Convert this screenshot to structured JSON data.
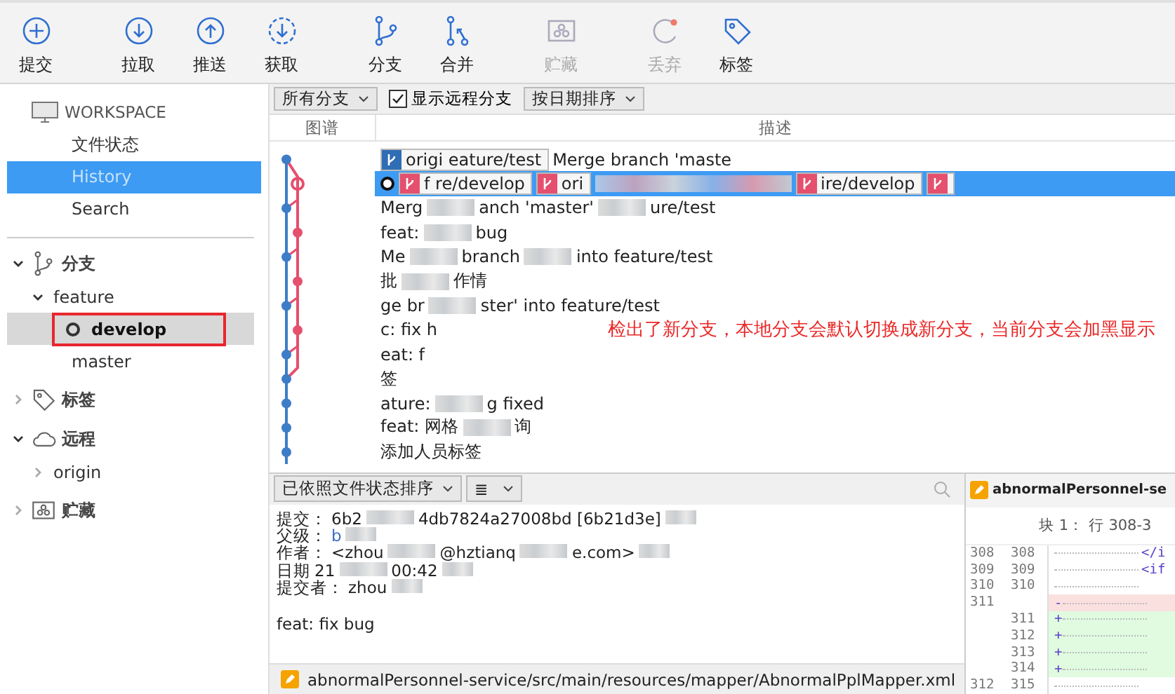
{
  "toolbar": [
    {
      "label": "提交",
      "disabled": false
    },
    {
      "label": "拉取",
      "disabled": false
    },
    {
      "label": "推送",
      "disabled": false
    },
    {
      "label": "获取",
      "disabled": false
    },
    {
      "label": "分支",
      "disabled": false
    },
    {
      "label": "合并",
      "disabled": false
    },
    {
      "label": "贮藏",
      "disabled": true
    },
    {
      "label": "丢弃",
      "disabled": true
    },
    {
      "label": "标签",
      "disabled": false
    }
  ],
  "sidebar": {
    "workspace": "WORKSPACE",
    "workspace_items": [
      {
        "label": "文件状态",
        "selected": false
      },
      {
        "label": "History",
        "selected": true
      },
      {
        "label": "Search",
        "selected": false
      }
    ],
    "sections": [
      {
        "label": "分支",
        "expanded": true,
        "children": [
          {
            "label": "feature",
            "expanded": true,
            "children": [
              {
                "label": "develop",
                "current": true,
                "highlighted": true
              }
            ]
          },
          {
            "label": "master",
            "current": false,
            "highlighted": false
          }
        ]
      },
      {
        "label": "标签",
        "expanded": false
      },
      {
        "label": "远程",
        "expanded": true,
        "children": [
          {
            "label": "origin",
            "expanded": false
          }
        ]
      },
      {
        "label": "贮藏",
        "expanded": false
      }
    ]
  },
  "filter_bar": {
    "branch_filter": "所有分支",
    "show_remote": {
      "label": "显示远程分支",
      "checked": true
    },
    "sort": "按日期排序"
  },
  "columns": [
    "图谱",
    "描述"
  ],
  "commits": [
    {
      "selected": false,
      "head": false,
      "kind": "main",
      "badges": [
        {
          "label": "origi eature/test",
          "color": "#2f6db5"
        }
      ],
      "parts": [
        "Merge branch 'maste"
      ]
    },
    {
      "selected": true,
      "head": true,
      "kind": "side",
      "badges": [
        {
          "label": "f re/develop",
          "color": "#e5506e"
        },
        {
          "label": "ori",
          "color": "#e5506e"
        }
      ],
      "tail_badges": [
        {
          "label": "ire/develop",
          "color": "#e5506e"
        },
        {
          "color": "#e5506e"
        }
      ]
    },
    {
      "selected": false,
      "head": false,
      "kind": "main",
      "parts": [
        "Merg",
        "anch 'master'",
        "ure/test"
      ]
    },
    {
      "selected": false,
      "head": false,
      "kind": "side",
      "parts": [
        "feat:",
        "bug"
      ]
    },
    {
      "selected": false,
      "head": false,
      "kind": "main",
      "parts": [
        "Me",
        "branch",
        "into feature/test"
      ]
    },
    {
      "selected": false,
      "head": false,
      "kind": "side",
      "parts": [
        "批",
        "作情"
      ]
    },
    {
      "selected": false,
      "head": false,
      "kind": "main",
      "parts": [
        "ge br",
        "ster' into feature/test"
      ]
    },
    {
      "selected": false,
      "head": false,
      "kind": "side",
      "parts": [
        "c: fix h"
      ],
      "note": "检出了新分支，本地分支会默认切换成新分支，当前分支会加黑显示"
    },
    {
      "selected": false,
      "head": false,
      "kind": "main",
      "parts": [
        "eat: f"
      ]
    },
    {
      "selected": false,
      "head": false,
      "kind": "main",
      "parts": [
        "签"
      ]
    },
    {
      "selected": false,
      "head": false,
      "kind": "main",
      "parts": [
        "ature:",
        "g fixed"
      ]
    },
    {
      "selected": false,
      "head": false,
      "kind": "main",
      "parts": [
        "feat: 网格",
        "询"
      ]
    },
    {
      "selected": false,
      "head": false,
      "kind": "main",
      "parts": [
        "添加人员标签"
      ]
    }
  ],
  "details_toolbar": {
    "sort": "已依照文件状态排序",
    "view": "≣"
  },
  "details": [
    {
      "label": "提交：",
      "parts": [
        "6b2",
        "4db7824a27008bd [6b21d3e]"
      ],
      "kind": "text"
    },
    {
      "label": "父级：",
      "parts": [
        "b"
      ],
      "kind": "link"
    },
    {
      "label": "作者：",
      "parts": [
        "<zhou",
        "@hztianq",
        "e.com>"
      ],
      "kind": "text"
    },
    {
      "label": "日期",
      "parts": [
        "21",
        "00:42"
      ],
      "kind": "text"
    },
    {
      "label": "提交者：",
      "parts": [
        "zhou"
      ],
      "kind": "text"
    }
  ],
  "message": "feat: fix bug",
  "files": [
    {
      "path": "abnormalPersonnel-service/src/main/resources/mapper/AbnormalPplMapper.xml",
      "kind": "modified"
    }
  ],
  "diff": {
    "file": "abnormalPersonnel-se",
    "hunk": "块 1： 行 308-3",
    "lines": [
      {
        "old": "308",
        "new": "308",
        "kind": "context",
        "code": "</i"
      },
      {
        "old": "309",
        "new": "309",
        "kind": "context",
        "code": "<if"
      },
      {
        "old": "310",
        "new": "310",
        "kind": "context"
      },
      {
        "old": "311",
        "kind": "removed",
        "marker": "-"
      },
      {
        "new": "311",
        "kind": "added",
        "marker": "+"
      },
      {
        "new": "312",
        "kind": "added",
        "marker": "+"
      },
      {
        "new": "313",
        "kind": "added",
        "marker": "+"
      },
      {
        "new": "314",
        "kind": "added",
        "marker": "+"
      },
      {
        "old": "312",
        "new": "315",
        "kind": "context"
      }
    ]
  }
}
